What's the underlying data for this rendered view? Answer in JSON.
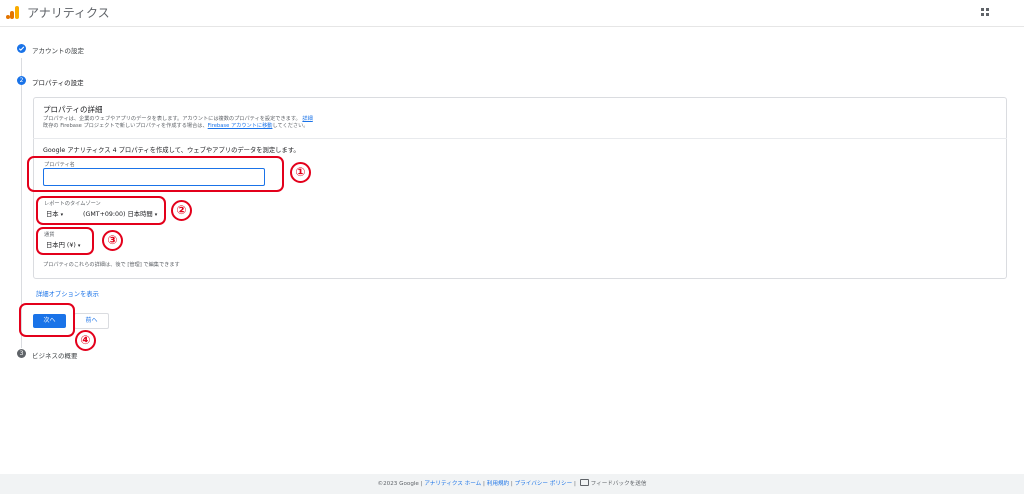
{
  "header": {
    "title": "アナリティクス",
    "logo_icon": "analytics-logo-icon",
    "apps_icon": "apps-grid-icon"
  },
  "steps": [
    {
      "number": "✓",
      "label": "アカウントの設定",
      "state": "done"
    },
    {
      "number": "2",
      "label": "プロパティの設定",
      "state": "active"
    },
    {
      "number": "3",
      "label": "ビジネスの概要",
      "state": "pending"
    }
  ],
  "property_details": {
    "title": "プロパティの詳細",
    "desc_line1": "プロパティは、企業のウェブやアプリのデータを表します。アカウントには複数のプロパティを設定できます。",
    "desc_link1": "詳細",
    "desc_line2_prefix": "既存の Firebase プロジェクトで新しいプロパティを作成する場合は、",
    "desc_link2": "Firebase アカウントに移動",
    "desc_line2_suffix": "してください。",
    "instruction": "Google アナリティクス 4 プロパティを作成して、ウェブやアプリのデータを測定します。",
    "name_label": "プロパティ名",
    "name_value": "",
    "timezone_label": "レポートのタイムゾーン",
    "country_value": "日本",
    "timezone_value": "(GMT+09:00) 日本時間",
    "currency_label": "通貨",
    "currency_value": "日本円 (¥)",
    "note": "プロパティのこれらの詳細は、後で [管理] で編集できます"
  },
  "advanced_link": "詳細オプションを表示",
  "buttons": {
    "next": "次へ",
    "prev": "前へ"
  },
  "annotations": [
    "①",
    "②",
    "③",
    "④"
  ],
  "footer": {
    "copyright": "©2023 Google",
    "home": "アナリティクス ホーム",
    "terms": "利用規約",
    "privacy": "プライバシー ポリシー",
    "feedback": "フィードバックを送信"
  },
  "colors": {
    "accent": "#1a73e8",
    "annotation": "#e3001b",
    "done": "#1a73e8",
    "pending": "#5f6368"
  }
}
